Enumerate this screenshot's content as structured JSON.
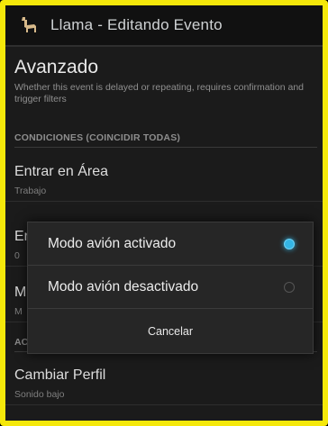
{
  "window": {
    "title": "Llama - Editando Evento",
    "icon": "llama-icon"
  },
  "section": {
    "title": "Avanzado",
    "summary": "Whether this event is delayed or repeating, requires confirmation and trigger filters"
  },
  "conditions": {
    "header": "CONDICIONES (COINCIDIR TODAS)",
    "items": [
      {
        "title": "Entrar en Área",
        "summary": "Trabajo"
      },
      {
        "title": "Er",
        "summary": "0"
      },
      {
        "title": "M",
        "summary": "M"
      }
    ]
  },
  "actions": {
    "header": "AC",
    "items": [
      {
        "title": "Cambiar Perfil",
        "summary": "Sonido bajo"
      }
    ]
  },
  "dialog": {
    "options": [
      {
        "label": "Modo avión activado",
        "selected": true
      },
      {
        "label": "Modo avión desactivado",
        "selected": false
      }
    ],
    "cancel_label": "Cancelar"
  },
  "colors": {
    "accent": "#34b5e5",
    "frame": "#f5e80a"
  }
}
